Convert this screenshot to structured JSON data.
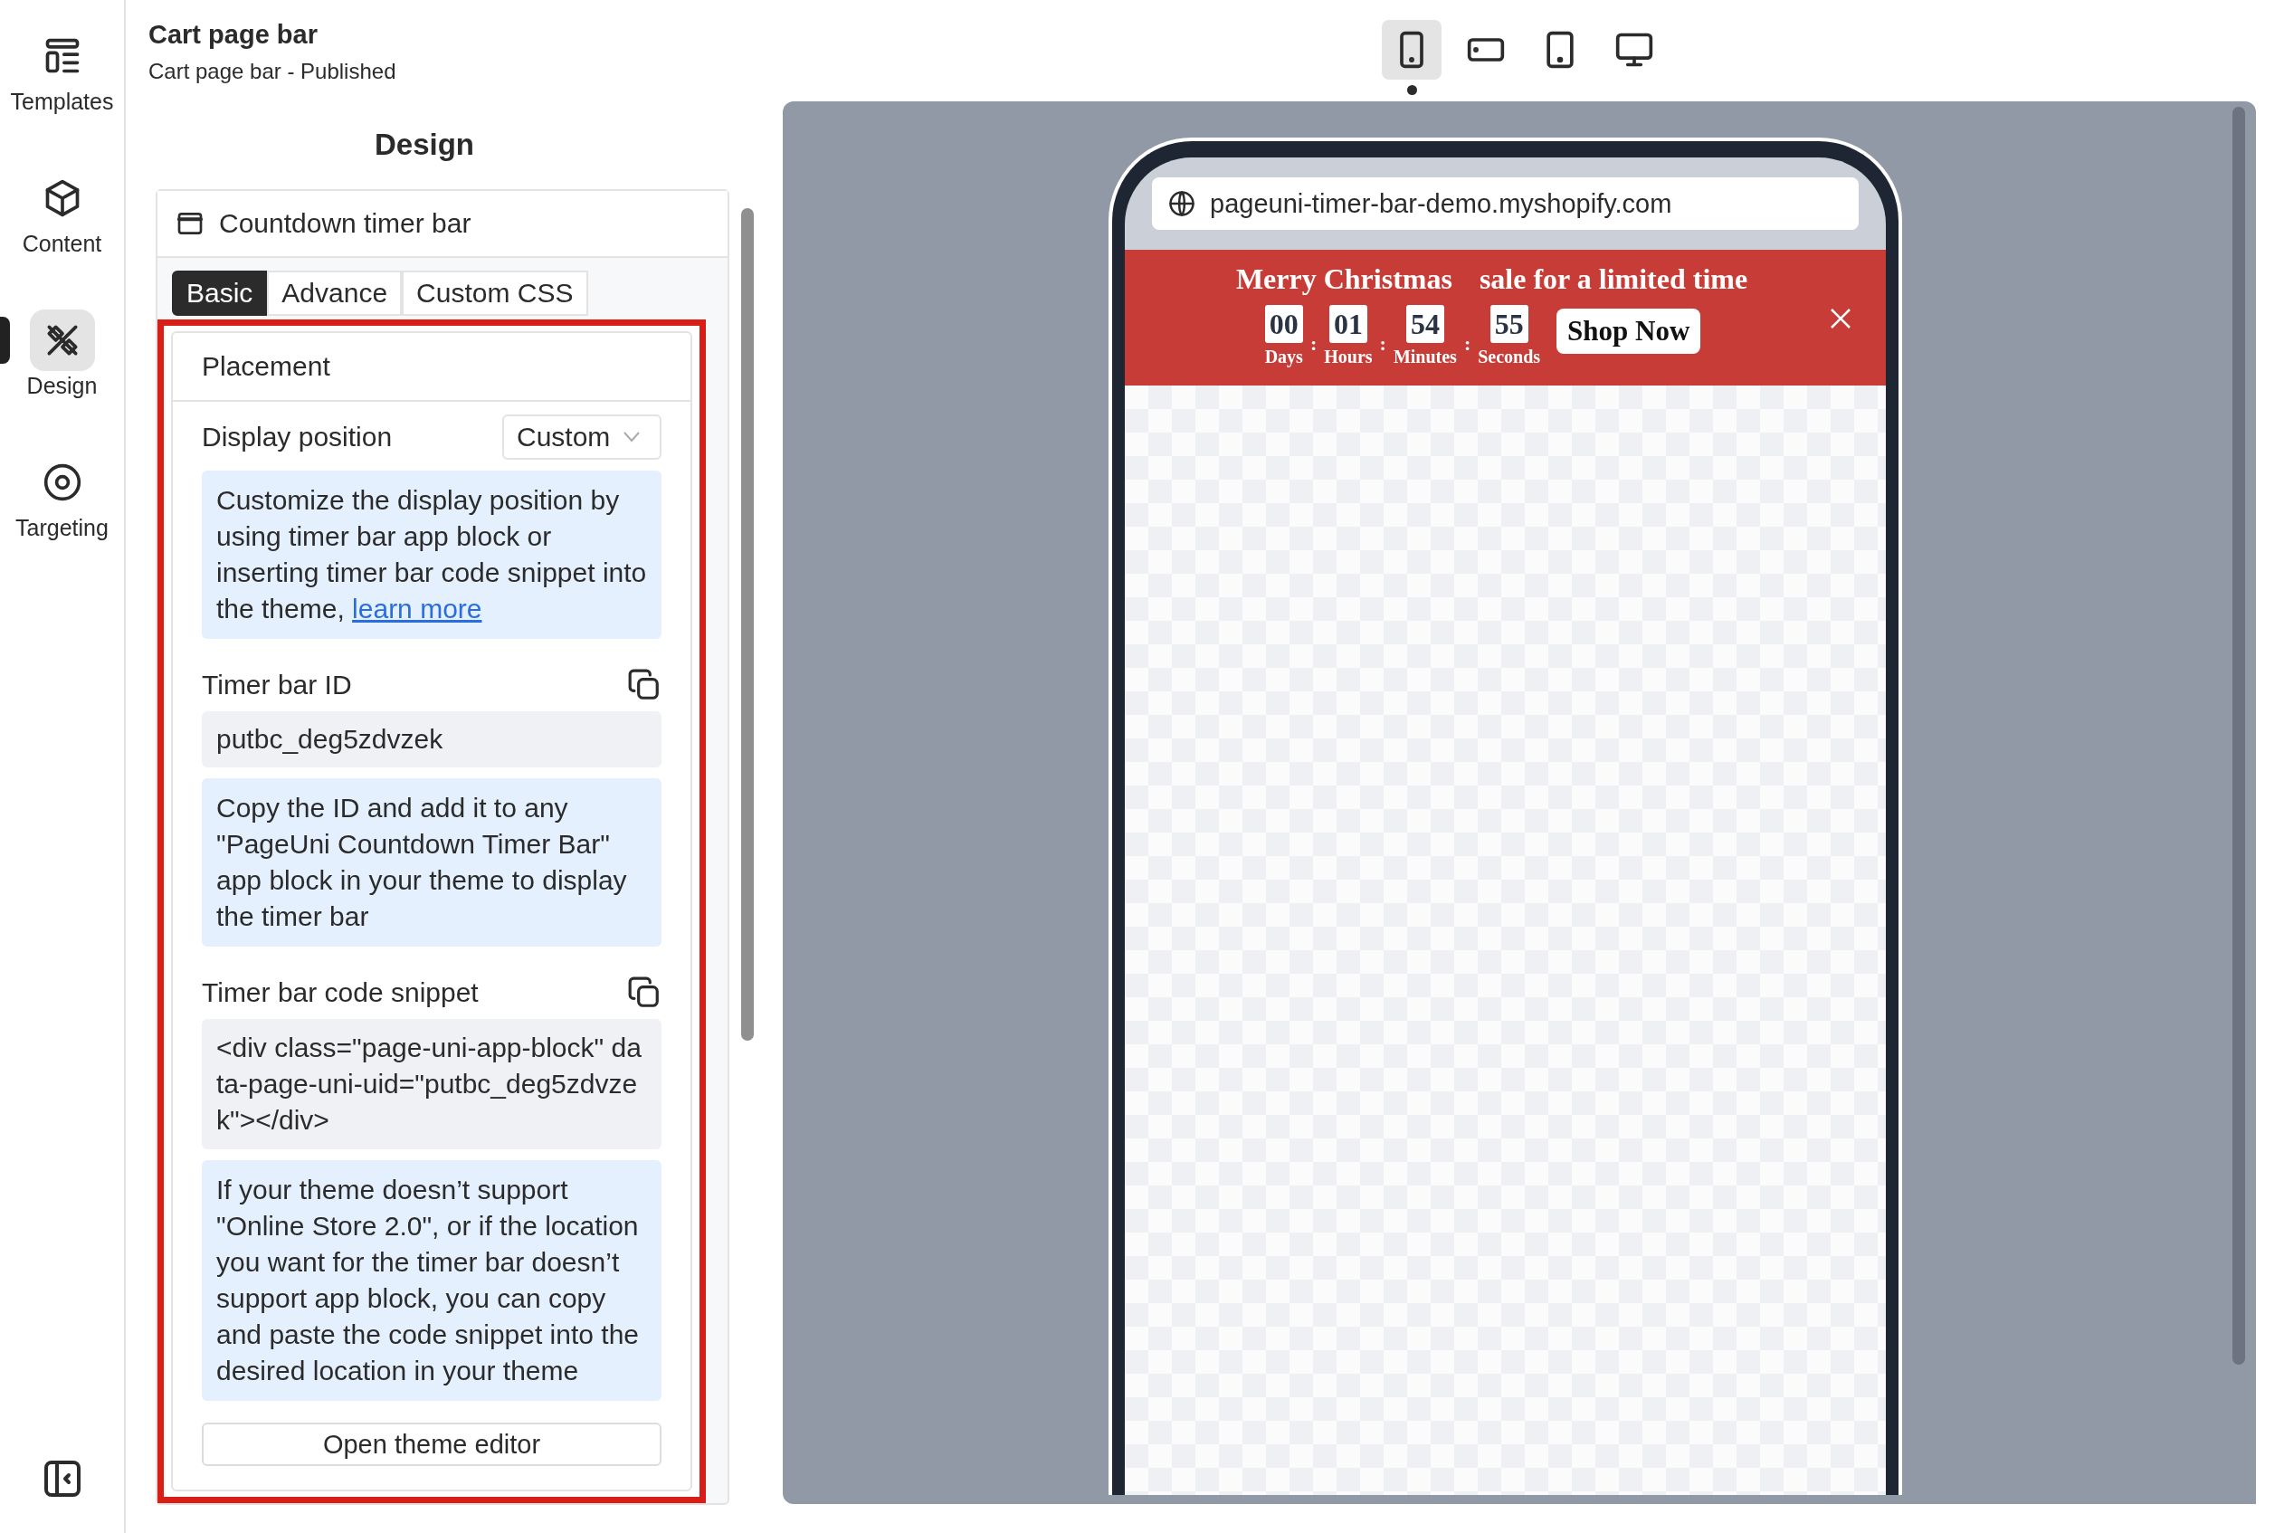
{
  "nav": {
    "items": [
      {
        "label": "Templates",
        "selected": false
      },
      {
        "label": "Content",
        "selected": false
      },
      {
        "label": "Design",
        "selected": true
      },
      {
        "label": "Targeting",
        "selected": false
      }
    ]
  },
  "header": {
    "title": "Cart page bar",
    "subtitle": "Cart page bar - Published"
  },
  "panel": {
    "heading": "Design",
    "card": {
      "title": "Countdown timer bar",
      "tabs": [
        {
          "label": "Basic",
          "selected": true
        },
        {
          "label": "Advance",
          "selected": false
        },
        {
          "label": "Custom CSS",
          "selected": false
        }
      ],
      "placement": {
        "title": "Placement",
        "display_position": {
          "label": "Display position",
          "value": "Custom"
        },
        "notice": {
          "text": "Customize the display position by using timer bar app block or inserting timer bar code snippet into the theme, ",
          "link": "learn more"
        },
        "timer_id": {
          "label": "Timer bar ID",
          "value": "putbc_deg5zdvzek",
          "note": "Copy the ID and add it to any \"PageUni Countdown Timer Bar\" app block in your theme to display the timer bar"
        },
        "snippet": {
          "label": "Timer bar code snippet",
          "value": "<div class=\"page-uni-app-block\" data-page-uni-uid=\"putbc_deg5zdvzek\"></div>",
          "note": "If your theme doesn’t support \"Online Store 2.0\", or if the location you want for the timer bar doesn’t support app block, you can copy and paste the code snippet into the desired location in your theme"
        },
        "button": "Open theme editor"
      }
    }
  },
  "devices": [
    {
      "selected": true
    },
    {
      "selected": false
    },
    {
      "selected": false
    },
    {
      "selected": false
    }
  ],
  "preview": {
    "url": "pageuni-timer-bar-demo.myshopify.com",
    "banner": {
      "title": "Merry Christmas",
      "subtitle": "sale for a limited time",
      "countdown": [
        {
          "value": "00",
          "unit": "Days"
        },
        {
          "value": "01",
          "unit": "Hours"
        },
        {
          "value": "54",
          "unit": "Minutes"
        },
        {
          "value": "55",
          "unit": "Seconds"
        }
      ],
      "separator": ":",
      "button": "Shop Now"
    }
  }
}
